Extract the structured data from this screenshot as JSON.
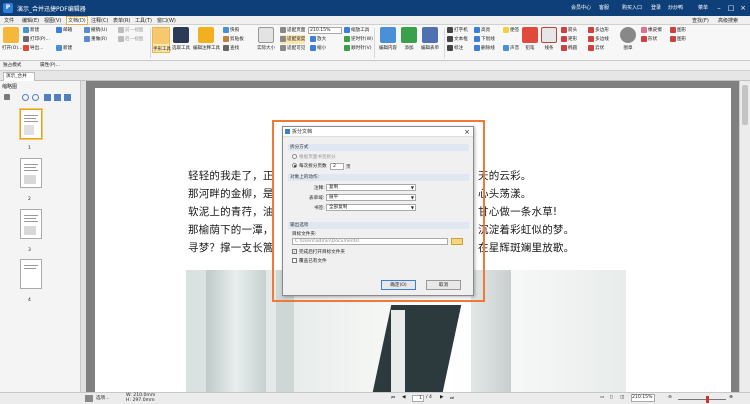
{
  "app": {
    "logo_letter": "P",
    "title": "演示_合并迅捷PDF编辑器",
    "right_items": [
      "会员中心",
      "客服",
      "购买入口",
      "登录",
      "炒炒鸭",
      "菜单"
    ]
  },
  "menu": [
    "文件",
    "编辑(E)",
    "视图(V)",
    "文档(D)",
    "注释(C)",
    "表单(R)",
    "工具(T)",
    "窗口(W)"
  ],
  "menu_active_index": 3,
  "ribbon_right": [
    "查找(F)",
    "高级搜索"
  ],
  "ribbon": {
    "open": "打开(O)...",
    "small_left": [
      "新建",
      "打印(P)...",
      "导出...",
      "新建"
    ],
    "mail": "邮箱",
    "undo": "撤销(U)",
    "redo": "重做(R)",
    "prev": "前一视图",
    "next": "后一视图",
    "hand": "手形工具",
    "select": "选取工具",
    "edit_content": "编辑注释工具",
    "snapshot": "快照",
    "clipboard": "剪贴板",
    "find": "查找",
    "actual_size": "实际大小",
    "fit_page": "适配页面",
    "fit_width": "适配宽度",
    "fit_visible": "适配可见",
    "zoom_value": "210.15%",
    "zoom_in": "放大",
    "zoom_out": "缩小",
    "zoom_tool": "缩放工具",
    "rotate_left": "逆时针(W)",
    "rotate_right": "顺时针(V)",
    "edit_content2": "编辑内容",
    "add": "添加",
    "edit_form": "编辑表单",
    "typewriter": "打字机",
    "textbox": "文本框",
    "callout": "标注",
    "highlight": "高亮",
    "underline": "下划线",
    "strike": "删除线",
    "note": "便签",
    "sound": "声音",
    "stamp": "图章",
    "pencil": "铅笔",
    "eraser": "橡皮擦",
    "line_tool": "线条",
    "arrow": "箭头",
    "rect": "矩形",
    "polygon": "多边形",
    "polyline": "多边线",
    "cloud": "云状",
    "ellipse": "椭圆",
    "shape1": "形状",
    "shape2": "图形",
    "shape3": "图形"
  },
  "quickbar": [
    "独占模式",
    "属性(P)..."
  ],
  "tab": "演示_合并",
  "sidebar": {
    "header": "缩略图",
    "pages": [
      "1",
      "2",
      "3",
      "4"
    ]
  },
  "document": {
    "lines": [
      "轻轻的我走了，正",
      "那河畔的金柳，是",
      "软泥上的青荇，油",
      "那榆荫下的一潭，",
      "寻梦？撑一支长篙"
    ],
    "lines_right": [
      "天的云彩。",
      "心头荡漾。",
      "甘心做一条水草!",
      "沉淀着彩虹似的梦。",
      "在星辉斑斓里放歌。"
    ]
  },
  "dialog": {
    "title": "拆分文档",
    "group1": "拆分方式",
    "opt_bookmark": "根据页面书签拆分",
    "opt_pages": "每次拆分页数",
    "pages_value": "2",
    "pages_unit": "页",
    "group2": "对象上的动作:",
    "annot_label": "注释:",
    "annot_value": "复制",
    "form_label": "表单域:",
    "form_value": "展平",
    "bookmark_label": "书签:",
    "bookmark_value": "全部复制",
    "group3": "输出选项",
    "target_label": "目标文件夹:",
    "target_value": "C:\\Users\\admin\\Documents\\",
    "check_open": "完成后打开目标文件夹",
    "check_overwrite": "覆盖已有文件",
    "ok": "确定(O)",
    "cancel": "取消"
  },
  "status": {
    "select": "选项...",
    "size_w": "W: 210.0mm",
    "size_h": "H: 297.0mm",
    "page": "1",
    "page_total": "/ 4",
    "zoom": "210.15%"
  },
  "colors": {
    "titlebar": "#0f3f78",
    "dialog_border": "#f07838",
    "accent": "#3c7fd6"
  }
}
